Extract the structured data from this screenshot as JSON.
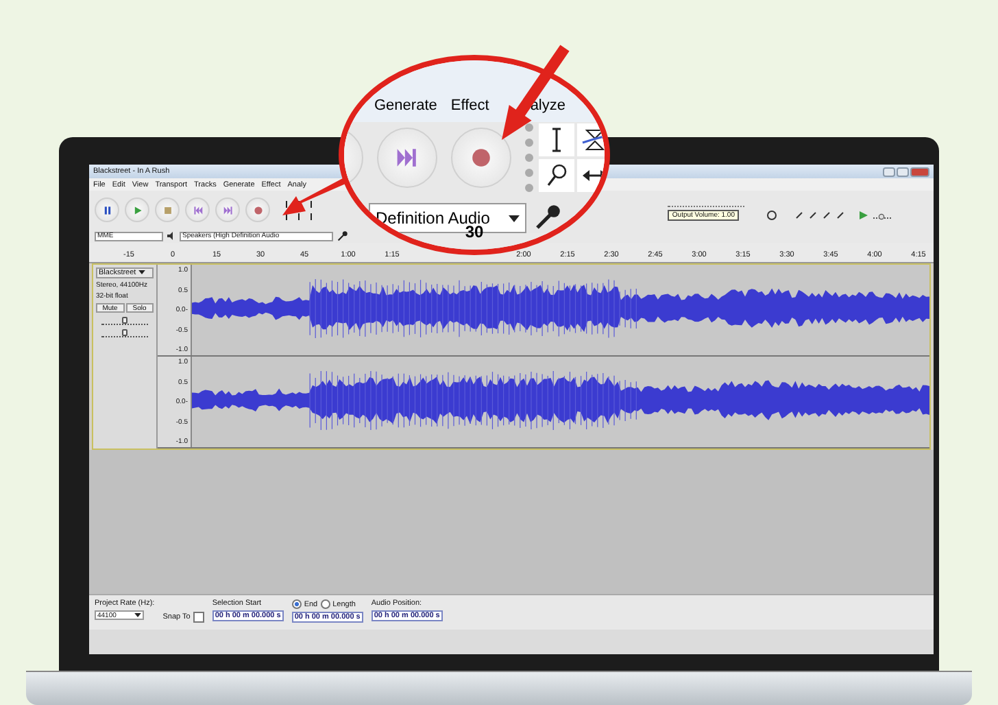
{
  "window": {
    "title": "Blackstreet - In A Rush"
  },
  "menu": [
    "File",
    "Edit",
    "View",
    "Transport",
    "Tracks",
    "Generate",
    "Effect",
    "Analy"
  ],
  "transport": [
    {
      "kind": "pause"
    },
    {
      "kind": "play"
    },
    {
      "kind": "stop"
    },
    {
      "kind": "start"
    },
    {
      "kind": "end"
    },
    {
      "kind": "record"
    }
  ],
  "devices": {
    "host": "MME",
    "output": "Speakers (High Definition Audio"
  },
  "tooltip": "Output Volume: 1.00",
  "ruler": [
    "-15",
    "0",
    "15",
    "30",
    "45",
    "1:00",
    "1:15",
    "2:00",
    "2:15",
    "2:30",
    "2:45",
    "3:00",
    "3:15",
    "3:30",
    "3:45",
    "4:00",
    "4:15"
  ],
  "track": {
    "name": "Blackstreet",
    "info": [
      "Stereo, 44100Hz",
      "32-bit float"
    ],
    "buttons": [
      "Mute",
      "Solo"
    ],
    "gain": {
      "level": 0.5
    },
    "pan": {
      "level": 0.5
    },
    "channels": [
      {
        "scale": [
          "1.0",
          "0.5",
          "0.0-",
          "-0.5",
          "-1.0"
        ]
      },
      {
        "scale": [
          "1.0",
          "0.5",
          "0.0-",
          "-0.5",
          "-1.0"
        ]
      }
    ]
  },
  "selection_bar": {
    "rate_label": "Project Rate (Hz):",
    "rate": "44100",
    "snap": {
      "label": "Snap To",
      "checked": false
    },
    "start_label": "Selection Start",
    "modes": [
      {
        "label": "End",
        "selected": true
      },
      {
        "label": "Length",
        "selected": false
      }
    ],
    "position_label": "Audio Position:",
    "times": [
      "00 h 00 m 00.000 s",
      "00 h 00 m 00.000 s",
      "00 h 00 m 00.000 s"
    ]
  },
  "callout": {
    "menu": [
      "Generate",
      "Effect",
      "alyze"
    ],
    "device": "Definition Audio",
    "ruler_label": "30"
  }
}
